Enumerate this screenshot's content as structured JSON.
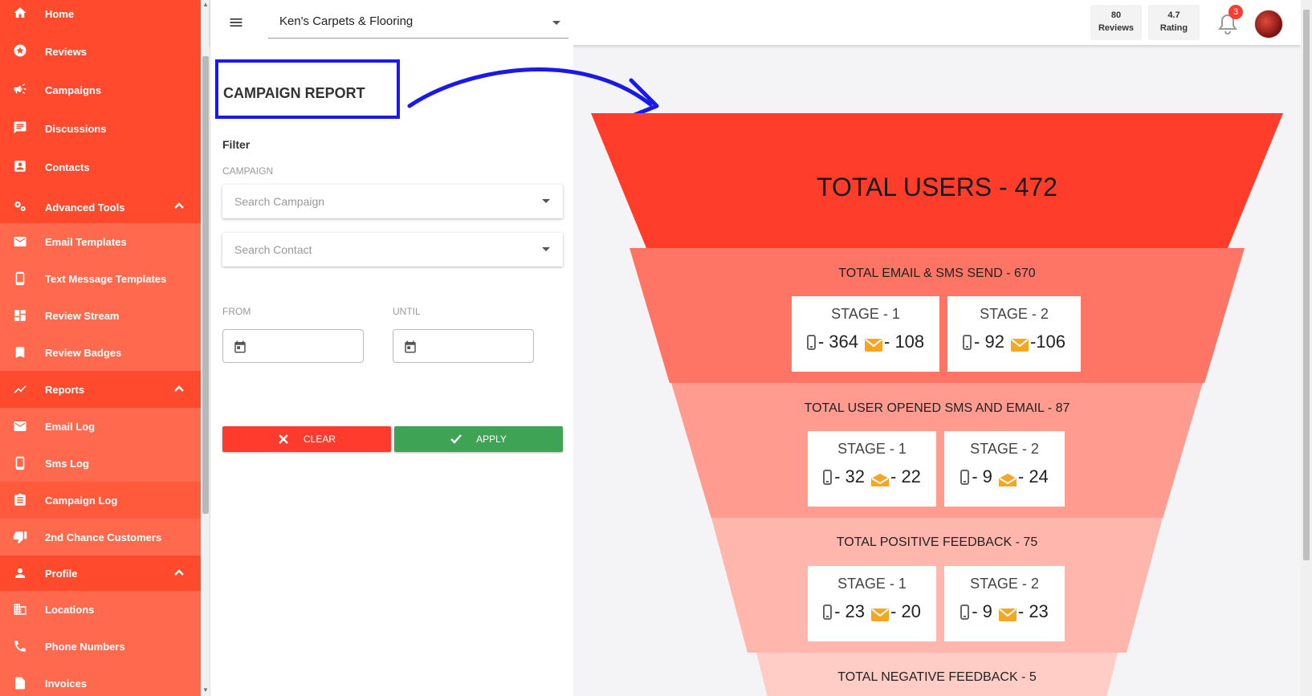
{
  "sidebar": {
    "items": [
      {
        "label": "Home",
        "icon": "home-icon"
      },
      {
        "label": "Reviews",
        "icon": "star-icon"
      },
      {
        "label": "Campaigns",
        "icon": "megaphone-icon"
      },
      {
        "label": "Discussions",
        "icon": "chat-icon"
      },
      {
        "label": "Contacts",
        "icon": "contacts-icon"
      },
      {
        "label": "Advanced Tools",
        "icon": "gears-icon"
      },
      {
        "label": "Email Templates",
        "icon": "mail-icon"
      },
      {
        "label": "Text Message Templates",
        "icon": "phone-icon"
      },
      {
        "label": "Review Stream",
        "icon": "dashboard-icon"
      },
      {
        "label": "Review Badges",
        "icon": "bookmark-icon"
      },
      {
        "label": "Reports",
        "icon": "chart-icon"
      },
      {
        "label": "Email Log",
        "icon": "mail-icon"
      },
      {
        "label": "Sms Log",
        "icon": "phone-icon"
      },
      {
        "label": "Campaign Log",
        "icon": "clipboard-icon"
      },
      {
        "label": "2nd Chance Customers",
        "icon": "thumbs-down-icon"
      },
      {
        "label": "Profile",
        "icon": "person-icon"
      },
      {
        "label": "Locations",
        "icon": "building-icon"
      },
      {
        "label": "Phone Numbers",
        "icon": "phone-call-icon"
      },
      {
        "label": "Invoices",
        "icon": "invoice-icon"
      }
    ]
  },
  "topbar": {
    "business": "Ken's Carpets & Flooring",
    "reviews_count": "80",
    "reviews_label": "Reviews",
    "rating_value": "4.7",
    "rating_label": "Rating",
    "notifications": "3"
  },
  "report": {
    "title": "CAMPAIGN REPORT",
    "filter_label": "Filter",
    "campaign_label": "CAMPAIGN",
    "search_campaign_placeholder": "Search Campaign",
    "search_contact_placeholder": "Search Contact",
    "from_label": "FROM",
    "until_label": "UNTIL",
    "clear_label": "CLEAR",
    "apply_label": "APPLY"
  },
  "funnel": {
    "total_users": "TOTAL USERS - 472",
    "sent": {
      "title": "TOTAL EMAIL & SMS SEND - 670",
      "stage1": {
        "label": "STAGE - 1",
        "sms": "- 364",
        "email": "- 108"
      },
      "stage2": {
        "label": "STAGE - 2",
        "sms": "- 92",
        "email": "-106"
      }
    },
    "opened": {
      "title": "TOTAL USER OPENED SMS AND EMAIL - 87",
      "stage1": {
        "label": "STAGE - 1",
        "sms": "- 32",
        "email": "- 22"
      },
      "stage2": {
        "label": "STAGE - 2",
        "sms": "- 9",
        "email": "- 24"
      }
    },
    "positive": {
      "title": "TOTAL POSITIVE FEEDBACK - 75",
      "stage1": {
        "label": "STAGE - 1",
        "sms": "- 23",
        "email": "- 20"
      },
      "stage2": {
        "label": "STAGE - 2",
        "sms": "- 9",
        "email": "- 23"
      }
    },
    "negative": {
      "title": "TOTAL NEGATIVE FEEDBACK - 5"
    }
  },
  "colors": {
    "sidebar": "#ff4a2e",
    "layer1": "#ff3d2a",
    "layer2": "#ff7565",
    "layer3": "#ff9c8f",
    "layer4": "#ffb7ad",
    "layer5": "#ffcdc6",
    "mail_icon": "#f5a623",
    "annotation": "#1a1ae6"
  }
}
